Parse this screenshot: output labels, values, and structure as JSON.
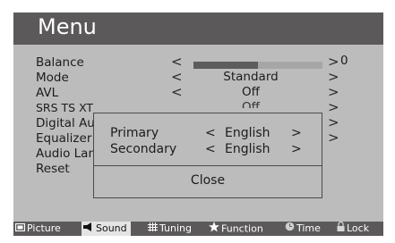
{
  "menu": {
    "title": "Menu",
    "items": [
      {
        "label": "Balance",
        "value": "0",
        "level": 0.5
      },
      {
        "label": "Mode",
        "value": "Standard"
      },
      {
        "label": "AVL",
        "value": "Off"
      },
      {
        "label": "SRS TS XT"
      },
      {
        "label": "Digital Audio Out"
      },
      {
        "label": "Equalizer"
      },
      {
        "label": "Audio Language"
      },
      {
        "label": "Reset"
      }
    ],
    "left_arrow": "<",
    "right_arrow": ">"
  },
  "popup": {
    "primary_label": "Primary",
    "primary_value": "English",
    "secondary_label": "Secondary",
    "secondary_value": "English",
    "left_arrow": "<",
    "right_arrow": ">",
    "close_label": "Close"
  },
  "footer": {
    "tabs": [
      {
        "label": "Picture",
        "icon": "picture-icon"
      },
      {
        "label": "Sound",
        "icon": "speaker-icon",
        "active": true
      },
      {
        "label": "Tuning",
        "icon": "grid-icon"
      },
      {
        "label": "Function",
        "icon": "star-icon"
      },
      {
        "label": "Time",
        "icon": "clock-icon"
      },
      {
        "label": "Lock",
        "icon": "lock-icon"
      }
    ]
  }
}
